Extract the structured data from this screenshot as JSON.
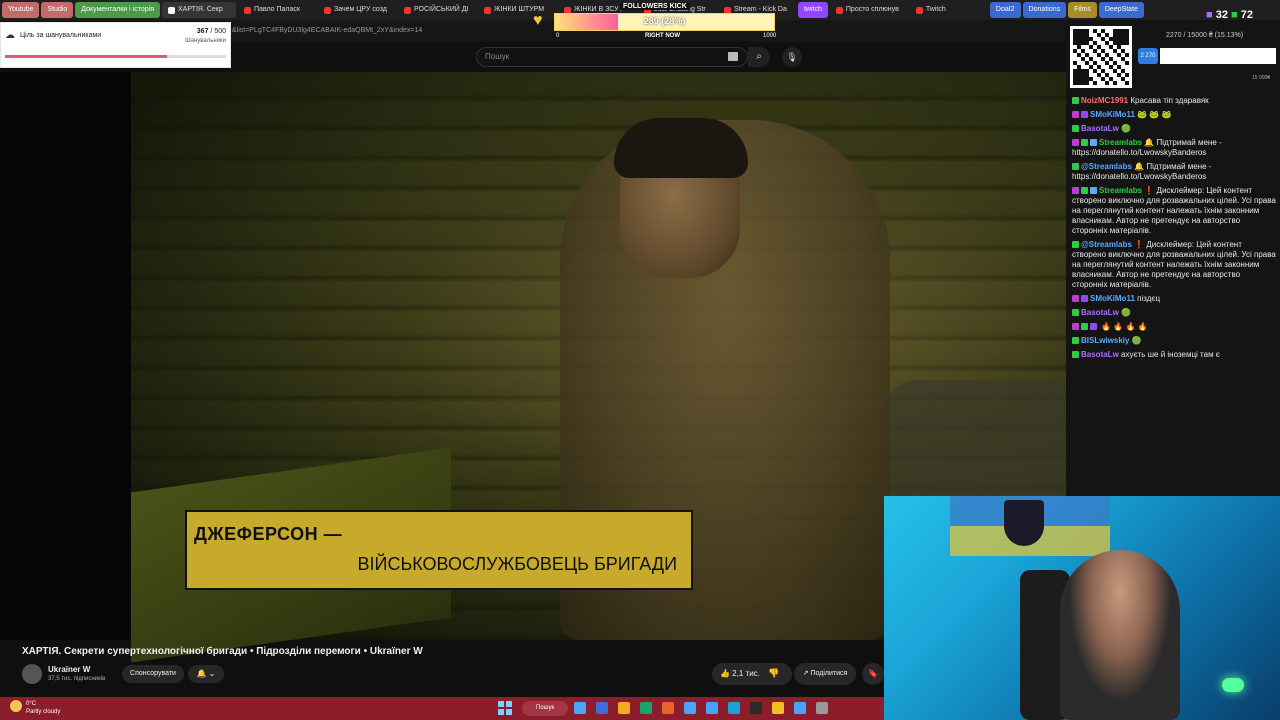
{
  "tabs": [
    {
      "label": "Youtube",
      "color": "#c56a6a"
    },
    {
      "label": "Studio",
      "color": "#c56a6a"
    },
    {
      "label": "Документалки і історія",
      "color": "#4a9a4a"
    },
    {
      "label": "ХАРТІЯ. Секр",
      "color": "#353535",
      "active": true
    },
    {
      "label": "Павло Паласк"
    },
    {
      "label": "Зачем ЦРУ созд"
    },
    {
      "label": "РОСІЙСЬКИЙ ДІ"
    },
    {
      "label": "ЖІНКИ ШТУРМ"
    },
    {
      "label": "ЖІНКИ В ЗСУ /"
    },
    {
      "label": "Just Chatting Str"
    },
    {
      "label": "Stream - Kick Da"
    },
    {
      "label": "twitch",
      "color": "#9146ff"
    },
    {
      "label": "Просто сплюнув"
    },
    {
      "label": "Twitch"
    },
    {
      "label": "DoaI2",
      "color": "#3a6ad0"
    },
    {
      "label": "Donations",
      "color": "#3a6ad0"
    },
    {
      "label": "Films",
      "color": "#a98b2a"
    },
    {
      "label": "DeepState",
      "color": "#3a6ad0"
    }
  ],
  "url_fragment": "&list=PLgTC4FByDU3lg4ECABAIK-edaQBMt_2xY&index=14",
  "search_placeholder": "Пошук",
  "goal_widget": {
    "title": "Ціль за шанувальниками",
    "count": "367",
    "total": "500",
    "sub": "Шанувальники",
    "progress": 0.734
  },
  "followers_widget": {
    "label": "FOLLOWERS KICK",
    "value_text": "289 (28%)",
    "progress": 0.289,
    "tick_start": "0",
    "tick_mid": "RIGHT NOW",
    "tick_end": "1000"
  },
  "video": {
    "lower_third_name": "ДЖЕФЕРСОН —",
    "lower_third_role": "ВІЙСЬКОВОСЛУЖБОВЕЦЬ БРИГАДИ",
    "title": "ХАРТІЯ. Секрети супертехнологічної бригади • Підрозділи перемоги • Ukraїner W",
    "channel": "Ukraїner W",
    "subs": "37,5 тис. підписників",
    "sponsor_label": "Спонсорувати",
    "bell": "🔔 ⌄",
    "likes": "👍 2,1 тис.",
    "share_label": "↗ Поділитися",
    "save_label": "🔖"
  },
  "top_counters": {
    "left": "32",
    "right": "72"
  },
  "sub_goal": {
    "text": "2270 / 15000 ₴ (15.13%)",
    "badge": "2 270",
    "end_tick": "15 000₴",
    "progress": 0.1513
  },
  "chat_messages": [
    {
      "badges": [
        "#2ecc40"
      ],
      "user": "NoizMC1991",
      "ucolor": "#ff6b6b",
      "text": "Красава тіп здаравяк"
    },
    {
      "badges": [
        "#c03ad6",
        "#9146ff"
      ],
      "user": "SMoKiMo11",
      "ucolor": "#5aa9ff",
      "text": "🐸 🐸 🐸"
    },
    {
      "badges": [
        "#2ecc40"
      ],
      "user": "BasotaLw",
      "ucolor": "#b26bff",
      "text": "🟢"
    },
    {
      "badges": [
        "#c03ad6",
        "#2ecc40",
        "#5aa9ff"
      ],
      "user": "Streamlabs",
      "ucolor": "#2ecc40",
      "text": "🔔 Підтримай мене - https://donatello.to/LwowskyBanderos"
    },
    {
      "badges": [
        "#2ecc40"
      ],
      "user": "@Streamlabs",
      "ucolor": "#5aa9ff",
      "text": "🔔 Підтримай мене - https://donatello.to/LwowskyBanderos"
    },
    {
      "badges": [
        "#c03ad6",
        "#2ecc40",
        "#5aa9ff"
      ],
      "user": "Streamlabs",
      "ucolor": "#2ecc40",
      "text": "❗ Дисклеймер: Цей контент створено виключно для розважальних цілей. Усі права на переглянутий контент належать їхнім законним власникам. Автор не претендує на авторство сторонніх матеріалів."
    },
    {
      "badges": [
        "#2ecc40"
      ],
      "user": "@Streamlabs",
      "ucolor": "#5aa9ff",
      "text": "❗ Дисклеймер: Цей контент створено виключно для розважальних цілей. Усі права на переглянутий контент належать їхнім законним власникам. Автор не претендує на авторство сторонніх матеріалів."
    },
    {
      "badges": [
        "#c03ad6",
        "#9146ff"
      ],
      "user": "SMoKiMo11",
      "ucolor": "#5aa9ff",
      "text": "піздєц"
    },
    {
      "badges": [
        "#2ecc40"
      ],
      "user": "BasotaLw",
      "ucolor": "#b26bff",
      "text": "🟢"
    },
    {
      "badges": [
        "#c03ad6",
        "#2ecc40",
        "#9146ff"
      ],
      "user": "",
      "ucolor": "#b26bff",
      "text": "🔥 🔥 🔥 🔥"
    },
    {
      "badges": [
        "#2ecc40"
      ],
      "user": "BISLwiwskiy",
      "ucolor": "#5aa9ff",
      "text": "🟢"
    },
    {
      "badges": [
        "#2ecc40"
      ],
      "user": "BasotaLw",
      "ucolor": "#b26bff",
      "text": "ахуєть ше й іноземці там є"
    }
  ],
  "weather": {
    "temp": "0°C",
    "cond": "Partly cloudy"
  },
  "taskbar_search": "Пошук",
  "taskbar_icons": [
    "#4aa3ff",
    "#3d6fd6",
    "#f4a922",
    "#1aa36b",
    "#e8632b",
    "#4aa3ff",
    "#4aa3ff",
    "#1aa3d8",
    "#2b2b2b",
    "#f4c020",
    "#4aa3ff",
    "#999"
  ]
}
